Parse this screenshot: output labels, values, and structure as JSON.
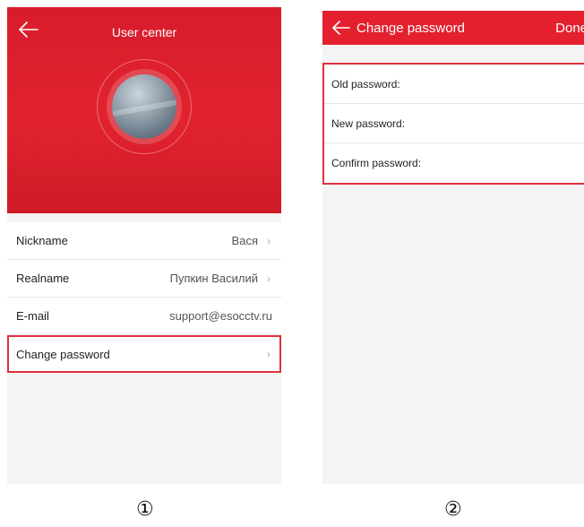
{
  "screen1": {
    "title": "User center",
    "rows": [
      {
        "label": "Nickname",
        "value": "Вася",
        "chevron": "›"
      },
      {
        "label": "Realname",
        "value": "Пупкин Василий",
        "chevron": "›"
      },
      {
        "label": "E-mail",
        "value": "support@esocctv.ru",
        "chevron": ""
      },
      {
        "label": "Change password",
        "value": "",
        "chevron": "›"
      }
    ]
  },
  "screen2": {
    "title": "Change password",
    "done_label": "Done",
    "fields": [
      {
        "label": "Old password:"
      },
      {
        "label": "New password:"
      },
      {
        "label": "Confirm password:"
      }
    ]
  },
  "markers": {
    "first": "①",
    "second": "②"
  },
  "colors": {
    "accent": "#e4202e",
    "highlight_border": "#e03040"
  },
  "icons": [
    "back-arrow-icon",
    "chevron-right-icon",
    "avatar-image"
  ]
}
